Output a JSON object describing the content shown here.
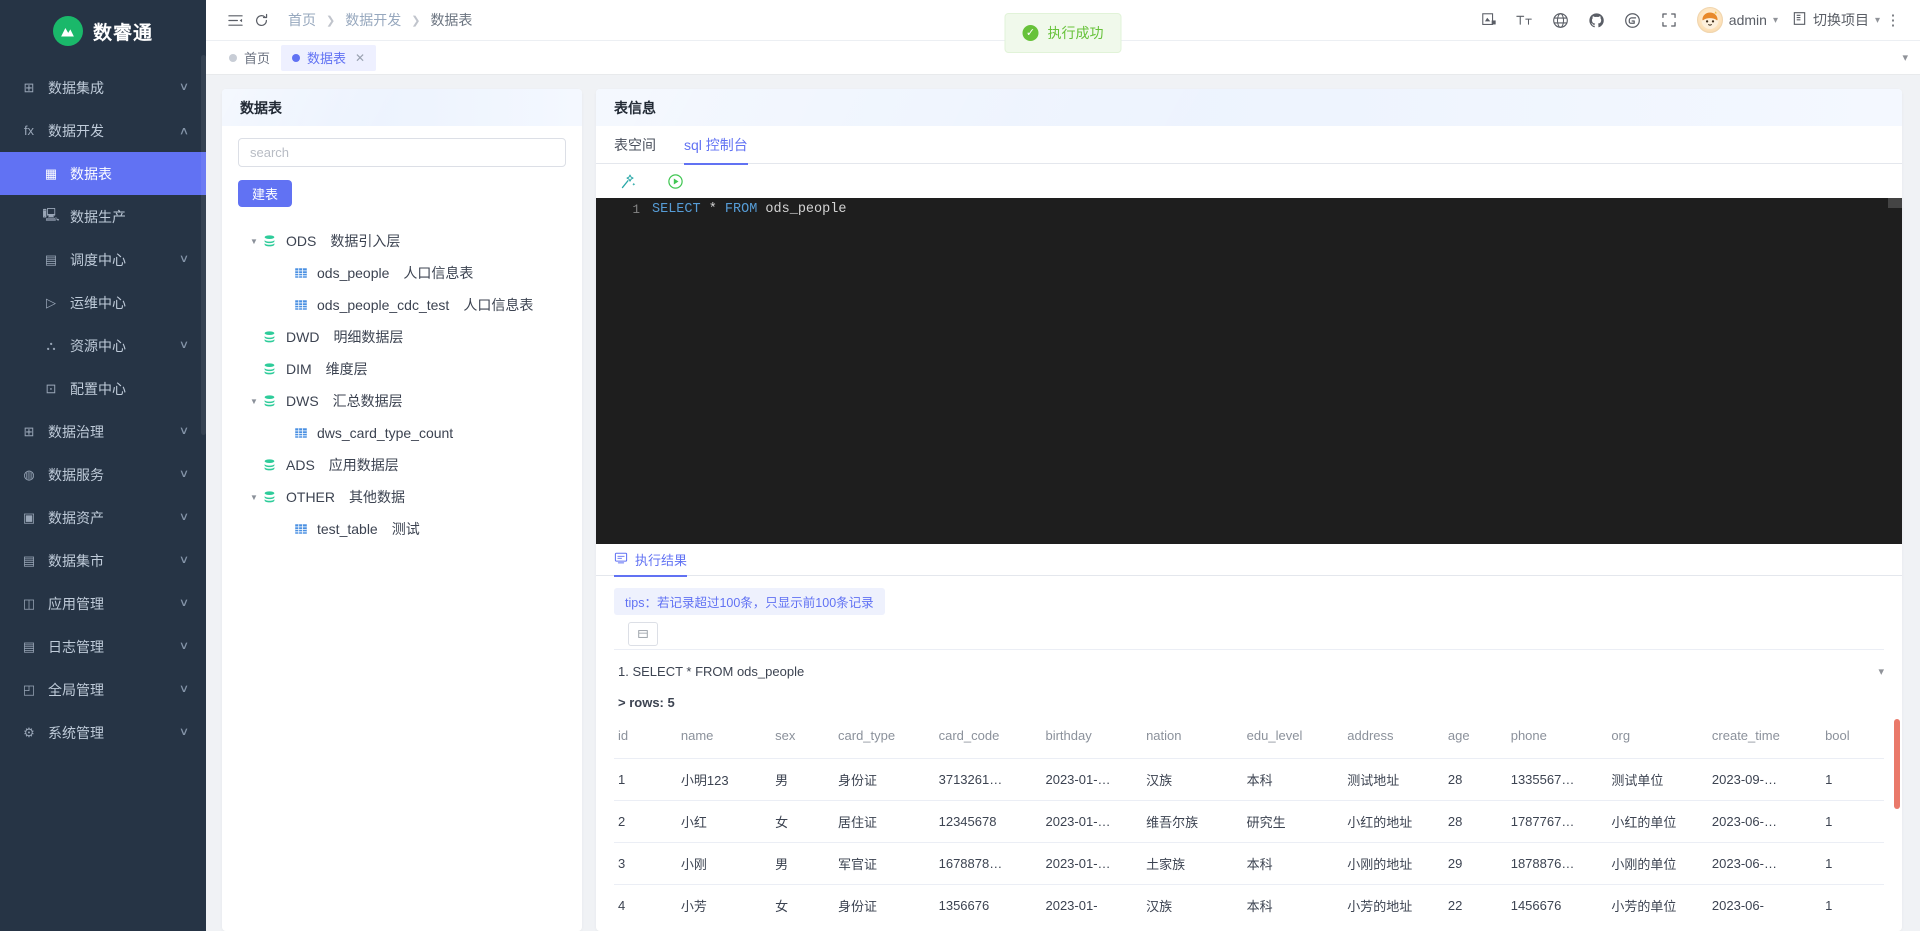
{
  "brand": {
    "name": "数睿通",
    "logo_glyph": "⩕",
    "logo_color": "#1ab86a"
  },
  "sidebar": {
    "items": [
      {
        "label": "数据集成",
        "icon": "integration-icon",
        "glyph": "⊞",
        "arrow": "down",
        "level": 1,
        "active": false
      },
      {
        "label": "数据开发",
        "icon": "development-icon",
        "glyph": "fx",
        "arrow": "up",
        "level": 1,
        "active": false
      },
      {
        "label": "数据表",
        "icon": "table-icon",
        "glyph": "▦",
        "arrow": "",
        "level": 2,
        "active": true
      },
      {
        "label": "数据生产",
        "icon": "production-icon",
        "glyph": "🖳",
        "arrow": "",
        "level": 2,
        "active": false
      },
      {
        "label": "调度中心",
        "icon": "schedule-icon",
        "glyph": "▤",
        "arrow": "down",
        "level": 2,
        "active": false
      },
      {
        "label": "运维中心",
        "icon": "ops-icon",
        "glyph": "▷",
        "arrow": "",
        "level": 2,
        "active": false
      },
      {
        "label": "资源中心",
        "icon": "resource-icon",
        "glyph": "⛬",
        "arrow": "down",
        "level": 2,
        "active": false
      },
      {
        "label": "配置中心",
        "icon": "config-icon",
        "glyph": "⊡",
        "arrow": "",
        "level": 2,
        "active": false
      },
      {
        "label": "数据治理",
        "icon": "governance-icon",
        "glyph": "⊞",
        "arrow": "down",
        "level": 1,
        "active": false
      },
      {
        "label": "数据服务",
        "icon": "service-icon",
        "glyph": "◍",
        "arrow": "down",
        "level": 1,
        "active": false
      },
      {
        "label": "数据资产",
        "icon": "asset-icon",
        "glyph": "▣",
        "arrow": "down",
        "level": 1,
        "active": false
      },
      {
        "label": "数据集市",
        "icon": "mart-icon",
        "glyph": "▤",
        "arrow": "down",
        "level": 1,
        "active": false
      },
      {
        "label": "应用管理",
        "icon": "app-icon",
        "glyph": "◫",
        "arrow": "down",
        "level": 1,
        "active": false
      },
      {
        "label": "日志管理",
        "icon": "log-icon",
        "glyph": "▤",
        "arrow": "down",
        "level": 1,
        "active": false
      },
      {
        "label": "全局管理",
        "icon": "global-icon",
        "glyph": "◰",
        "arrow": "down",
        "level": 1,
        "active": false
      },
      {
        "label": "系统管理",
        "icon": "system-icon",
        "glyph": "⚙",
        "arrow": "down",
        "level": 1,
        "active": false
      }
    ]
  },
  "topbar": {
    "collapse_icon": "menu-collapse-icon",
    "refresh_icon": "refresh-icon",
    "breadcrumb": [
      "首页",
      "数据开发",
      "数据表"
    ],
    "icons": [
      {
        "name": "screenshot-icon",
        "glyph": "⎙"
      },
      {
        "name": "font-size-icon",
        "glyph": "Tт"
      },
      {
        "name": "language-icon",
        "glyph": "⊕"
      },
      {
        "name": "github-icon",
        "glyph": "◕"
      },
      {
        "name": "gitee-icon",
        "glyph": "Ⓖ"
      },
      {
        "name": "fullscreen-icon",
        "glyph": "⛶"
      }
    ],
    "user": "admin",
    "project_switch": "切换项目",
    "more_icon": "more-vertical-icon"
  },
  "toast": {
    "text": "执行成功",
    "type": "success",
    "color": "#67c23a"
  },
  "tabs": [
    {
      "label": "首页",
      "active": false,
      "closable": false
    },
    {
      "label": "数据表",
      "active": true,
      "closable": true
    }
  ],
  "left_panel": {
    "title": "数据表",
    "search_placeholder": "search",
    "search_value": "",
    "create_button": "建表",
    "tree": [
      {
        "level": 1,
        "expanded": true,
        "code": "ODS",
        "desc": "数据引入层",
        "kind": "db"
      },
      {
        "level": 2,
        "expanded": null,
        "code": "ods_people",
        "desc": "人口信息表",
        "kind": "table"
      },
      {
        "level": 2,
        "expanded": null,
        "code": "ods_people_cdc_test",
        "desc": "人口信息表",
        "kind": "table"
      },
      {
        "level": 1,
        "expanded": false,
        "code": "DWD",
        "desc": "明细数据层",
        "kind": "db"
      },
      {
        "level": 1,
        "expanded": false,
        "code": "DIM",
        "desc": "维度层",
        "kind": "db"
      },
      {
        "level": 1,
        "expanded": true,
        "code": "DWS",
        "desc": "汇总数据层",
        "kind": "db"
      },
      {
        "level": 2,
        "expanded": null,
        "code": "dws_card_type_count",
        "desc": "",
        "kind": "table"
      },
      {
        "level": 1,
        "expanded": false,
        "code": "ADS",
        "desc": "应用数据层",
        "kind": "db"
      },
      {
        "level": 1,
        "expanded": true,
        "code": "OTHER",
        "desc": "其他数据",
        "kind": "db"
      },
      {
        "level": 2,
        "expanded": null,
        "code": "test_table",
        "desc": "测试",
        "kind": "table"
      }
    ]
  },
  "right_panel": {
    "title": "表信息",
    "sub_tabs": [
      {
        "label": "表空间",
        "active": false
      },
      {
        "label": "sql 控制台",
        "active": true
      }
    ],
    "toolbar": [
      {
        "name": "format-sql-icon",
        "glyph": "⚲"
      },
      {
        "name": "run-sql-icon",
        "glyph": "▶"
      }
    ],
    "editor": {
      "line_number": "1",
      "tokens": [
        {
          "text": "SELECT",
          "type": "keyword"
        },
        {
          "text": " * ",
          "type": "operator"
        },
        {
          "text": "FROM",
          "type": "keyword"
        },
        {
          "text": " ods_people",
          "type": "plain"
        }
      ]
    },
    "result": {
      "tab_label": "执行结果",
      "tab_icon": "result-icon",
      "tips": "tips：若记录超过100条，只显示前100条记录",
      "export_icon": "export-icon",
      "query_line": "1. SELECT * FROM ods_people",
      "rows_line": "> rows: 5",
      "collapse_icon": "chevron-down-icon"
    }
  },
  "table": {
    "columns": [
      "id",
      "name",
      "sex",
      "card_type",
      "card_code",
      "birthday",
      "nation",
      "edu_level",
      "address",
      "age",
      "phone",
      "org",
      "create_time",
      "bool"
    ],
    "rows": [
      [
        "1",
        "小明123",
        "男",
        "身份证",
        "3713261…",
        "2023-01-…",
        "汉族",
        "本科",
        "测试地址",
        "28",
        "1335567…",
        "测试单位",
        "2023-09-…",
        "1"
      ],
      [
        "2",
        "小红",
        "女",
        "居住证",
        "12345678",
        "2023-01-…",
        "维吾尔族",
        "研究生",
        "小红的地址",
        "28",
        "1787767…",
        "小红的单位",
        "2023-06-…",
        "1"
      ],
      [
        "3",
        "小刚",
        "男",
        "军官证",
        "1678878…",
        "2023-01-…",
        "土家族",
        "本科",
        "小刚的地址",
        "29",
        "1878876…",
        "小刚的单位",
        "2023-06-…",
        "1"
      ],
      [
        "4",
        "小芳",
        "女",
        "身份证",
        "1356676",
        "2023-01-",
        "汉族",
        "本科",
        "小芳的地址",
        "22",
        "1456676",
        "小芳的单位",
        "2023-06-",
        "1"
      ]
    ]
  }
}
